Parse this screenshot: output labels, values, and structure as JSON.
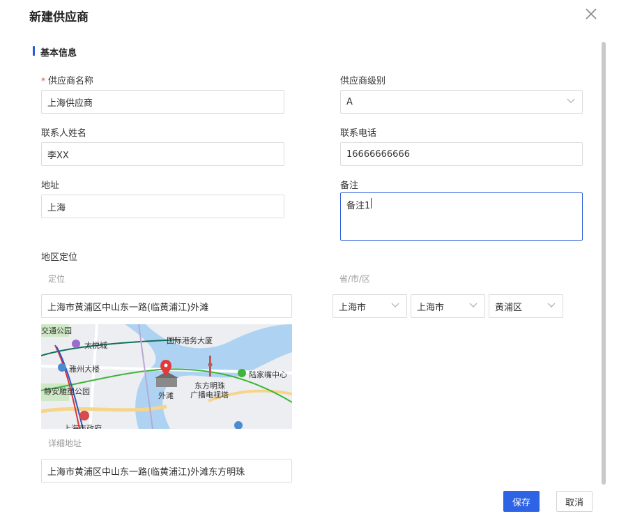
{
  "modal": {
    "title": "新建供应商",
    "section_title": "基本信息"
  },
  "form": {
    "supplier_name": {
      "required_mark": "*",
      "label": "供应商名称",
      "value": "上海供应商"
    },
    "supplier_level": {
      "label": "供应商级别",
      "value": "A"
    },
    "contact_name": {
      "label": "联系人姓名",
      "value": "李XX"
    },
    "contact_phone": {
      "label": "联系电话",
      "value": "16666666666"
    },
    "address": {
      "label": "地址",
      "value": "上海"
    },
    "remark": {
      "label": "备注",
      "value": "备注1"
    },
    "region": {
      "label": "地区定位",
      "location_label": "定位",
      "location_value": "上海市黄浦区中山东一路(临黄浦江)外滩",
      "pcd_label": "省/市/区",
      "province": "上海市",
      "city": "上海市",
      "district": "黄浦区",
      "detail_label": "详细地址",
      "detail_value": "上海市黄浦区中山东一路(临黄浦江)外滩东方明珠"
    }
  },
  "map": {
    "labels": [
      "交通公园",
      "太悦城",
      "国际港务大厦",
      "雅州大楼",
      "陆家嘴中心",
      "静安雕塑公园",
      "东方明珠",
      "广播电视塔",
      "外滩",
      "上海市政府"
    ]
  },
  "footer": {
    "save_label": "保存",
    "cancel_label": "取消"
  },
  "colors": {
    "accent": "#2f63e6",
    "required": "#e24b3b",
    "section_bar": "#2b5bd7"
  }
}
